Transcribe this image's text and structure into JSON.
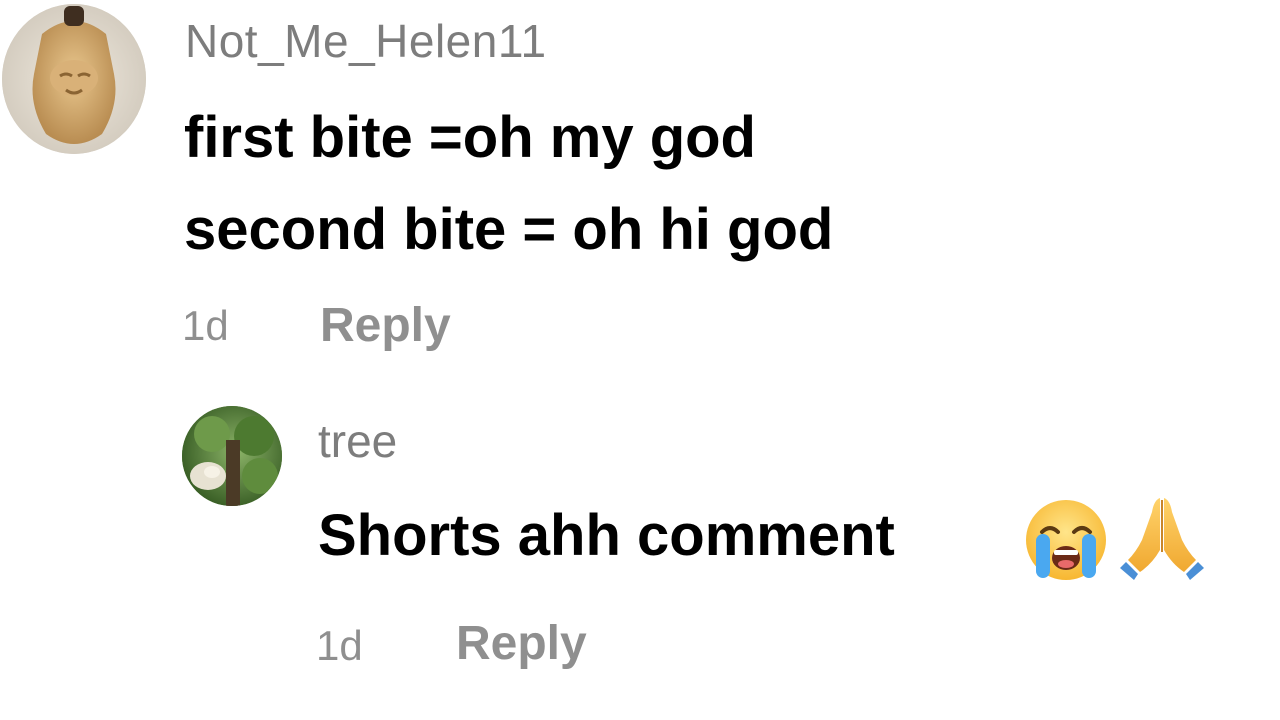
{
  "comments": [
    {
      "username": "Not_Me_Helen11",
      "avatar_icon": "user-avatar-photo-icon",
      "lines": [
        "first bite =oh my god",
        "second bite = oh hi god"
      ],
      "time": "1d",
      "reply_label": "Reply"
    },
    {
      "username": "tree",
      "avatar_icon": "user-avatar-photo-icon",
      "lines": [
        "Shorts ahh comment"
      ],
      "emojis": [
        "loudly-crying-face-icon",
        "folded-hands-icon"
      ],
      "time": "1d",
      "reply_label": "Reply"
    }
  ],
  "colors": {
    "username": "#7d7d7d",
    "comment_text": "#000000",
    "meta": "#8f8f8f",
    "background": "#ffffff"
  }
}
